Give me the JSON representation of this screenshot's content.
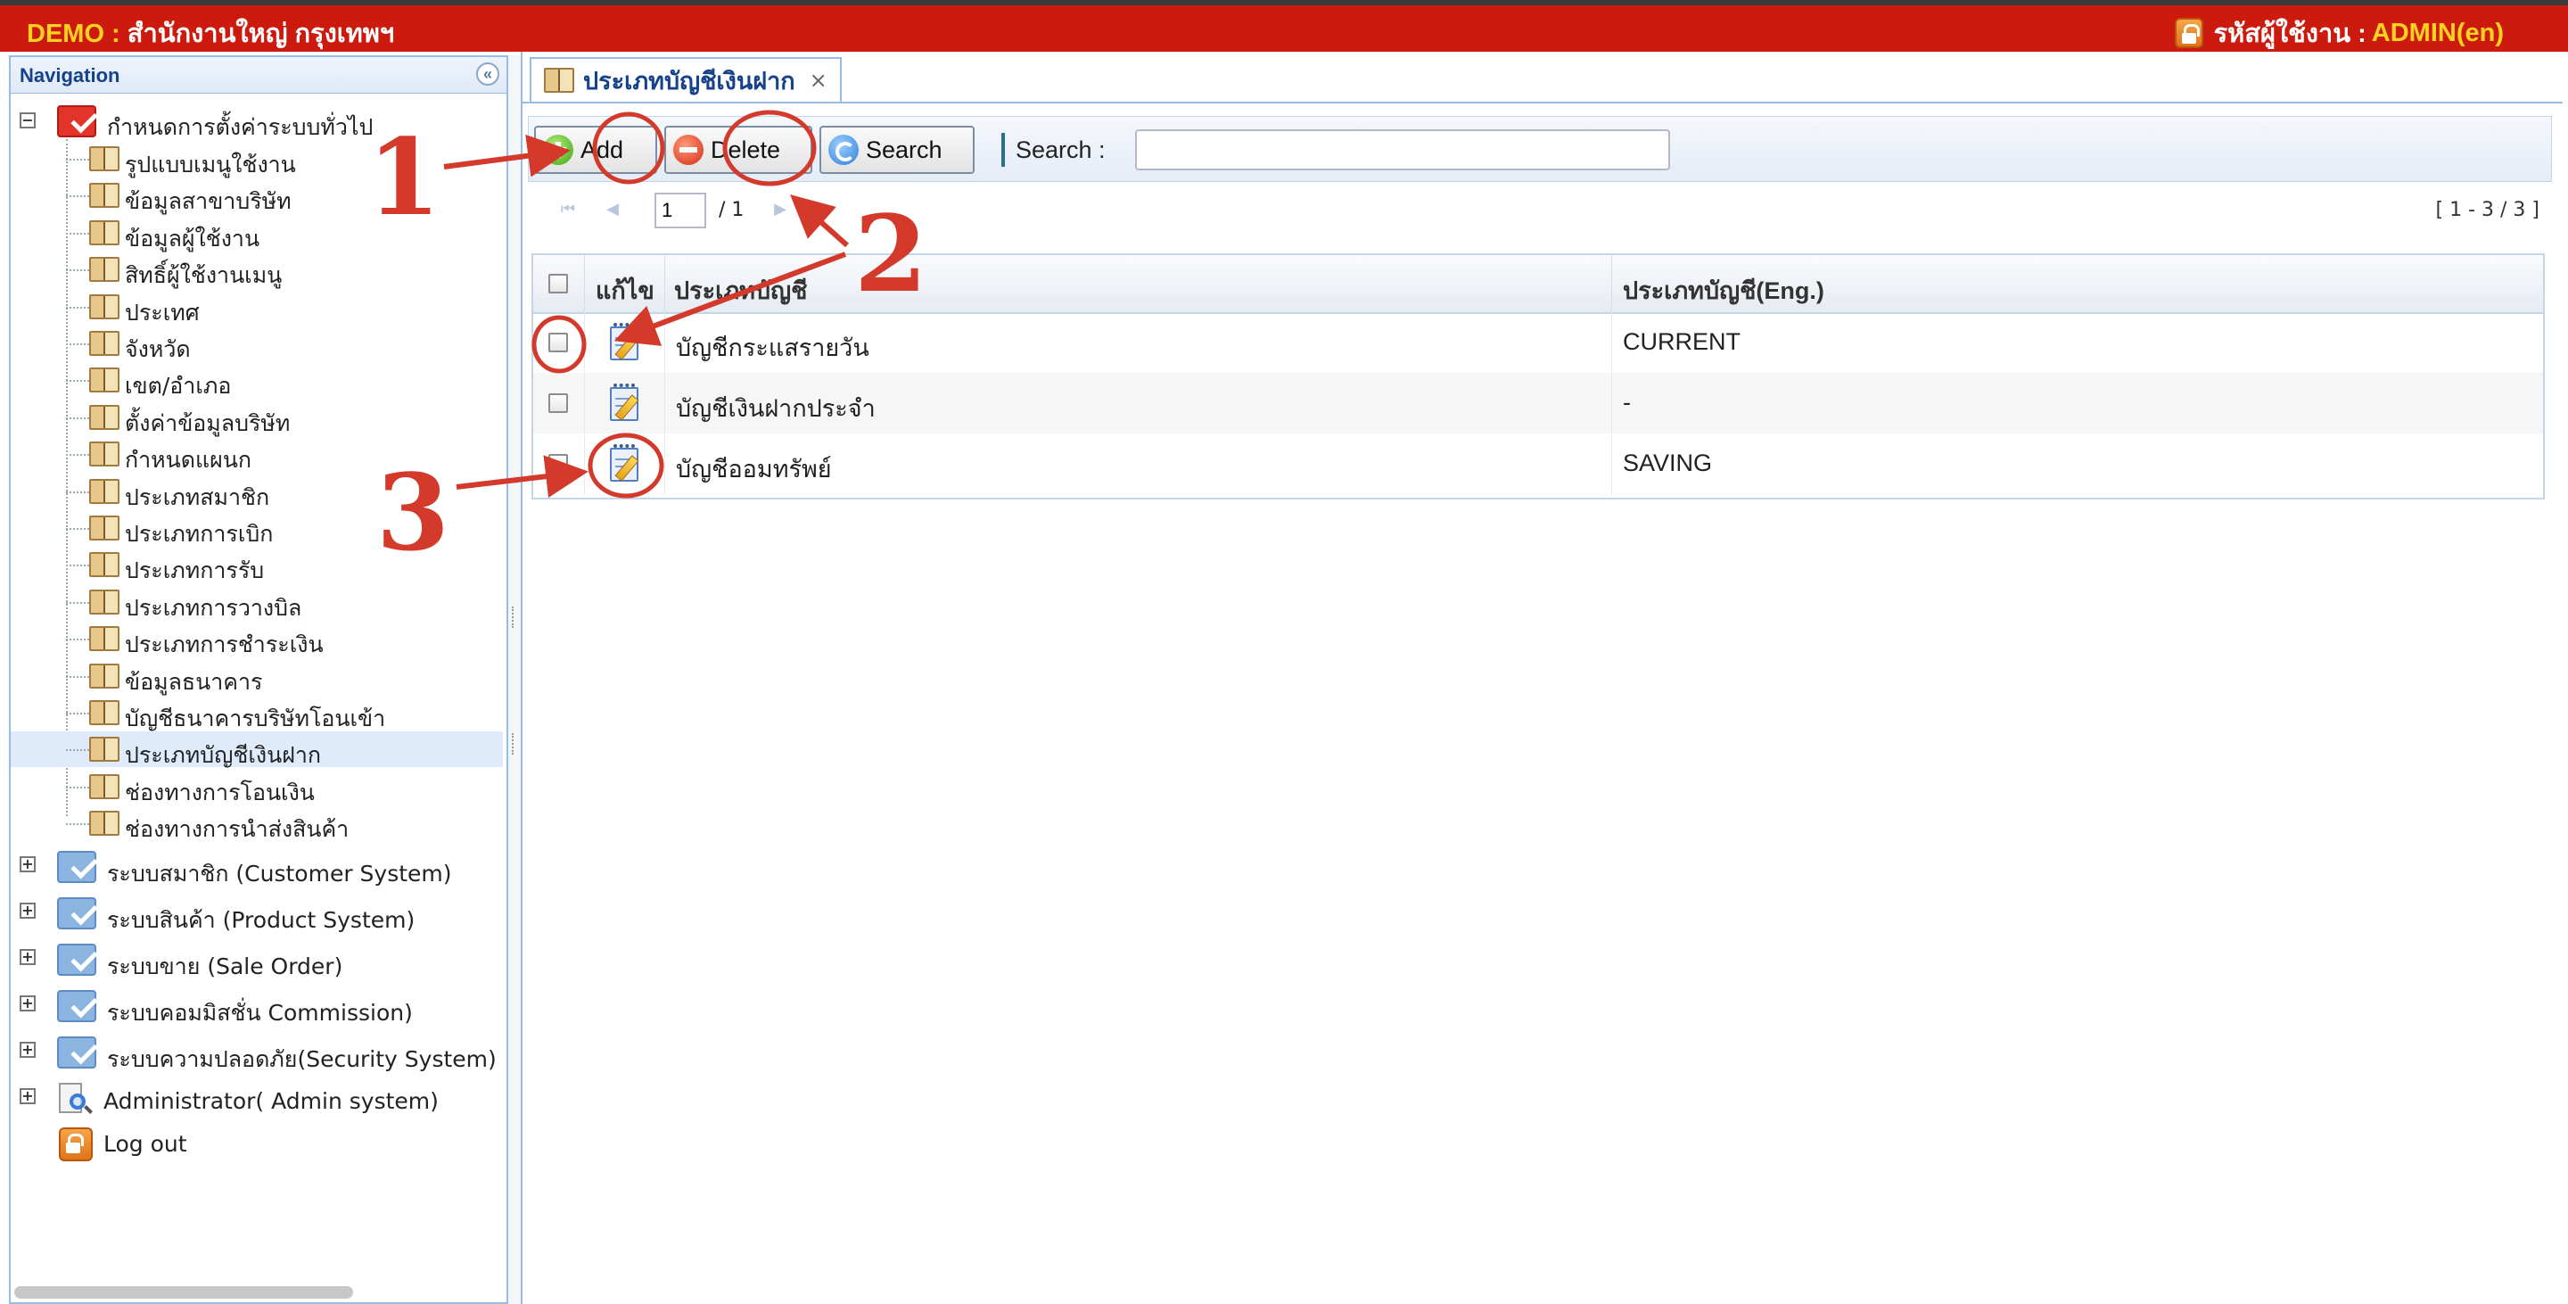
{
  "header": {
    "brand_prefix": "DEMO :",
    "brand_name": "สำนักงานใหญ่ กรุงเทพฯ",
    "user_label": "รหัสผู้ใช้งาน :",
    "user_id": "ADMIN(en)",
    "lock_icon": "lock-icon",
    "bg_color": "#cc1a0e",
    "accent_color": "#ffd21f"
  },
  "nav": {
    "title": "Navigation",
    "collapse_glyph": "«",
    "root": {
      "label": "กำหนดการตั้งค่าระบบทั่วไป",
      "expander": "−",
      "children": [
        "รูปแบบเมนูใช้งาน",
        "ข้อมูลสาขาบริษัท",
        "ข้อมูลผู้ใช้งาน",
        "สิทธิ์ผู้ใช้งานเมนู",
        "ประเทศ",
        "จังหวัด",
        "เขต/อำเภอ",
        "ตั้งค่าข้อมูลบริษัท",
        "กำหนดแผนก",
        "ประเภทสมาชิก",
        "ประเภทการเบิก",
        "ประเภทการรับ",
        "ประเภทการวางบิล",
        "ประเภทการชำระเงิน",
        "ข้อมูลธนาคาร",
        "บัญชีธนาคารบริษัทโอนเข้า",
        "ประเภทบัญชีเงินฝาก",
        "ช่องทางการโอนเงิน",
        "ช่องทางการนำส่งสินค้า"
      ],
      "selected_index": 16
    },
    "groups": [
      {
        "label": "ระบบสมาชิก (Customer System)",
        "expander": "+"
      },
      {
        "label": "ระบบสินค้า (Product System)",
        "expander": "+"
      },
      {
        "label": "ระบบขาย (Sale Order)",
        "expander": "+"
      },
      {
        "label": "ระบบคอมมิสชั่น Commission)",
        "expander": "+"
      },
      {
        "label": "ระบบความปลอดภัย(Security System)",
        "expander": "+"
      }
    ],
    "admin": {
      "label": "Administrator( Admin system)",
      "expander": "+"
    },
    "logout": {
      "label": "Log out"
    }
  },
  "tab": {
    "title": "ประเภทบัญชีเงินฝาก",
    "close": "×"
  },
  "toolbar": {
    "add_label": "Add",
    "delete_label": "Delete",
    "search_btn_label": "Search",
    "search_label": "Search :",
    "search_value": ""
  },
  "pager": {
    "first": "⏮",
    "prev": "◀",
    "next": "▶",
    "last": "⏭",
    "page": "1",
    "total": "/ 1",
    "info": "[ 1 - 3 / 3 ]"
  },
  "grid": {
    "headers": {
      "edit": "แก้ไข",
      "type": "ประเภทบัญชี",
      "type_en": "ประเภทบัญชี(Eng.)"
    },
    "rows": [
      {
        "type": "บัญชีกระแสรายวัน",
        "type_en": "CURRENT"
      },
      {
        "type": "บัญชีเงินฝากประจำ",
        "type_en": "-"
      },
      {
        "type": "บัญชีออมทรัพย์",
        "type_en": "SAVING"
      }
    ]
  },
  "annotations": {
    "labels": [
      "1",
      "2",
      "3"
    ],
    "color": "#d33a2c"
  }
}
